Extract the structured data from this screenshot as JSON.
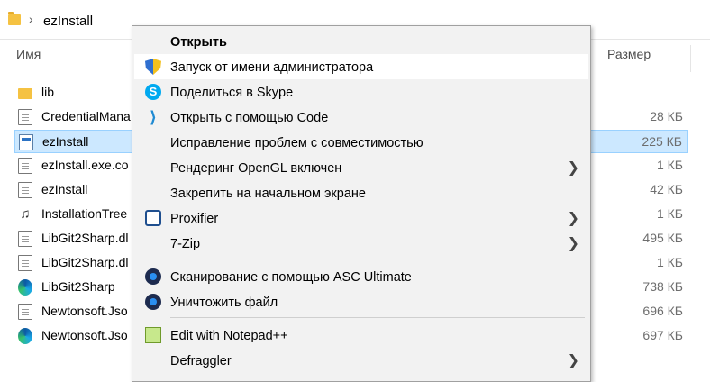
{
  "address_bar": {
    "crumb": "ezInstall"
  },
  "columns": {
    "name": "Имя",
    "size": "Размер"
  },
  "files": [
    {
      "name": "lib",
      "size": "",
      "icon": "folder-icon"
    },
    {
      "name": "CredentialMana",
      "size": "28 КБ",
      "icon": "document-icon"
    },
    {
      "name": "ezInstall",
      "size": "225 КБ",
      "icon": "application-icon",
      "selected": true
    },
    {
      "name": "ezInstall.exe.co",
      "size": "1 КБ",
      "icon": "config-file-icon"
    },
    {
      "name": "ezInstall",
      "size": "42 КБ",
      "icon": "document-icon"
    },
    {
      "name": "InstallationTree",
      "size": "1 КБ",
      "icon": "note-file-icon"
    },
    {
      "name": "LibGit2Sharp.dl",
      "size": "495 КБ",
      "icon": "document-icon"
    },
    {
      "name": "LibGit2Sharp.dl",
      "size": "1 КБ",
      "icon": "config-file-icon"
    },
    {
      "name": "LibGit2Sharp",
      "size": "738 КБ",
      "icon": "edge-icon"
    },
    {
      "name": "Newtonsoft.Jso",
      "size": "696 КБ",
      "icon": "document-icon"
    },
    {
      "name": "Newtonsoft.Jso",
      "size": "697 КБ",
      "icon": "edge-icon"
    }
  ],
  "context_menu": {
    "items": [
      {
        "label": "Открыть",
        "bold": true,
        "icon": ""
      },
      {
        "label": "Запуск от имени администратора",
        "icon": "uac-shield-icon",
        "hover": true
      },
      {
        "label": "Поделиться в Skype",
        "icon": "skype-icon"
      },
      {
        "label": "Открыть с помощью Code",
        "icon": "vscode-icon"
      },
      {
        "label": "Исправление проблем с совместимостью",
        "icon": ""
      },
      {
        "label": "Рендеринг OpenGL включен",
        "icon": "",
        "submenu": true
      },
      {
        "label": "Закрепить на начальном экране",
        "icon": ""
      },
      {
        "label": "Proxifier",
        "icon": "proxifier-icon",
        "submenu": true
      },
      {
        "label": "7-Zip",
        "icon": "",
        "submenu": true
      },
      {
        "label": "Сканирование с помощью ASC Ultimate",
        "icon": "asc-icon"
      },
      {
        "label": "Уничтожить файл",
        "icon": "asc-icon"
      },
      {
        "label": "Edit with Notepad++",
        "icon": "notepad-plus-plus-icon"
      },
      {
        "label": "Defraggler",
        "icon": "",
        "submenu": true
      }
    ],
    "skype_glyph": "S",
    "arrow_glyph": "❯"
  }
}
